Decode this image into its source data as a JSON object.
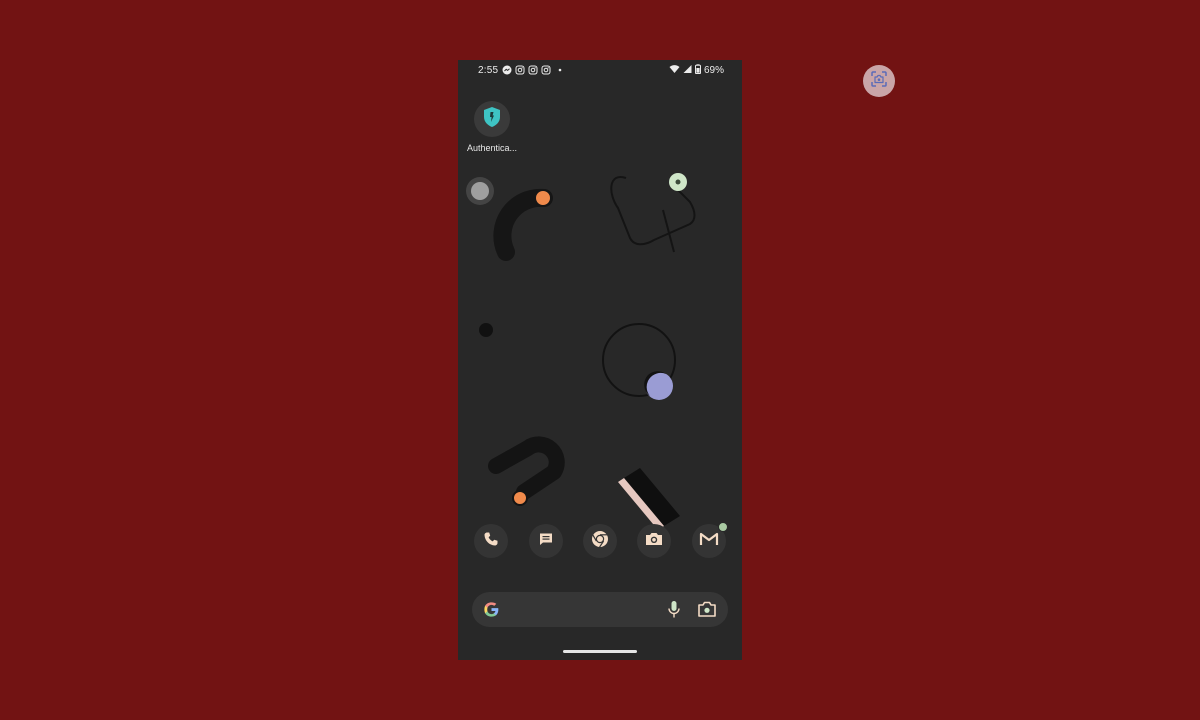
{
  "status_bar": {
    "time": "2:55",
    "battery": "69%",
    "notification_icons": [
      "messenger-icon",
      "instagram-icon",
      "instagram-icon",
      "instagram-icon",
      "more-dot-icon"
    ],
    "system_icons": [
      "wifi-icon",
      "cell-signal-icon",
      "battery-icon"
    ]
  },
  "home_screen": {
    "apps": [
      {
        "label": "Authentica...",
        "icon": "authenticator-shield-icon",
        "color": "#3ec4c4"
      }
    ],
    "dock": [
      {
        "icon": "phone-icon"
      },
      {
        "icon": "messages-icon"
      },
      {
        "icon": "chrome-icon"
      },
      {
        "icon": "camera-icon"
      },
      {
        "icon": "gmail-icon",
        "has_badge": true
      }
    ],
    "search_bar": {
      "icons": [
        "google-g-icon",
        "microphone-icon",
        "google-lens-icon"
      ]
    }
  },
  "colors": {
    "background": "#721313",
    "phone_surface": "#282828",
    "accent_orange": "#f08a4b",
    "accent_mint": "#cfe6c8",
    "accent_lavender": "#9a9cd4",
    "icon_tint": "#f4dcc6"
  }
}
